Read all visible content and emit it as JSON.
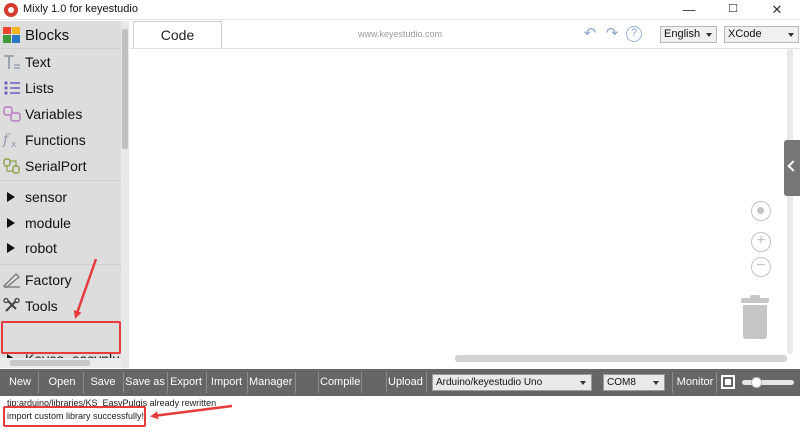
{
  "window": {
    "title": "Mixly 1.0 for keyestudio",
    "min_label": "—",
    "max_label": "☐",
    "close_label": "✕"
  },
  "sidebar": {
    "items": [
      {
        "label": "Blocks",
        "icon": "puzzle-icon"
      },
      {
        "label": "Text",
        "icon": "text-icon"
      },
      {
        "label": "Lists",
        "icon": "list-icon"
      },
      {
        "label": "Variables",
        "icon": "variables-icon"
      },
      {
        "label": "Functions",
        "icon": "function-icon"
      },
      {
        "label": "SerialPort",
        "icon": "serial-port-icon"
      },
      {
        "label": "sensor",
        "icon": "triangle-right-icon"
      },
      {
        "label": "module",
        "icon": "triangle-right-icon"
      },
      {
        "label": "robot",
        "icon": "triangle-right-icon"
      },
      {
        "label": "Factory",
        "icon": "factory-icon"
      },
      {
        "label": "Tools",
        "icon": "tools-icon"
      },
      {
        "label": "Keyes_easyplug",
        "icon": "triangle-right-icon"
      }
    ]
  },
  "header": {
    "tab_code": "Code",
    "site": "www.keyestudio.com",
    "undo_icon": "↶",
    "redo_icon": "↷",
    "help_icon": "?",
    "language": "English",
    "theme": "XCode"
  },
  "workspace": {
    "zoom_in": "+",
    "zoom_out": "−"
  },
  "toolbar": {
    "new": "New",
    "open": "Open",
    "save": "Save",
    "save_as": "Save as",
    "export": "Export",
    "import": "Import",
    "manager": "Manager",
    "compile": "Compile",
    "upload": "Upload",
    "board": "Arduino/keyestudio Uno",
    "port": "COM8",
    "monitor": "Monitor"
  },
  "output": {
    "line1": "tip:arduino/libraries/KS_EasyPulgis already rewritten",
    "line2": "import custom library successfully!"
  },
  "accent": {
    "highlight": "#e53b3b",
    "toolbar_bg": "#666666",
    "sidebar_bg": "#dddddd"
  }
}
